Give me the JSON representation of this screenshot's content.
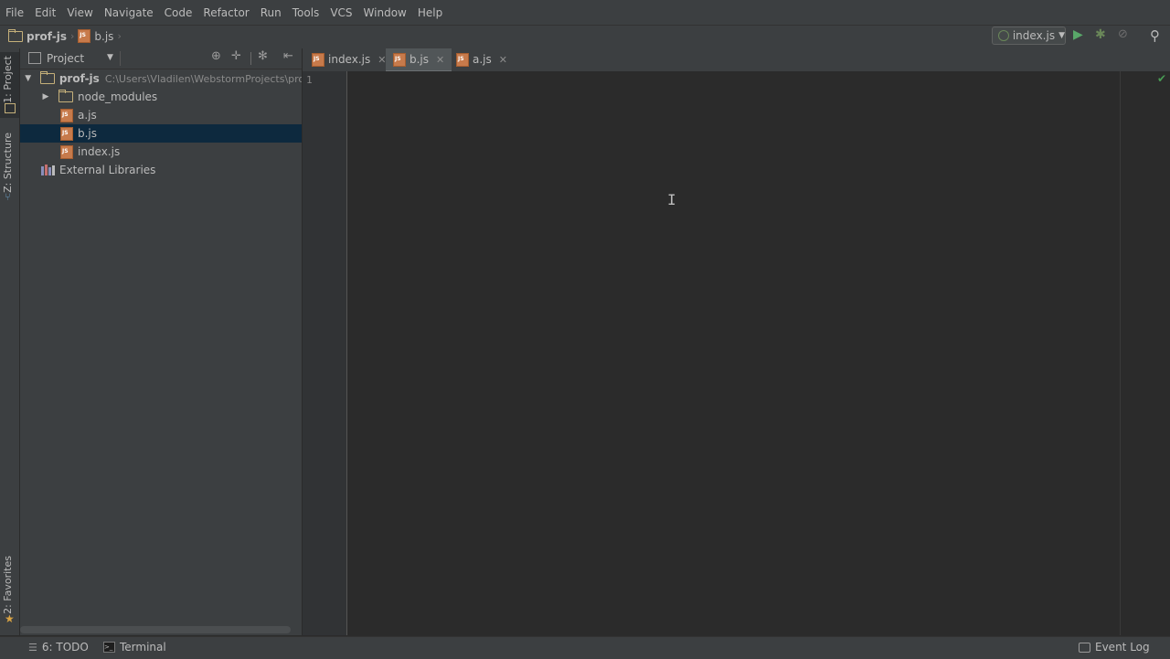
{
  "menu": [
    "File",
    "Edit",
    "View",
    "Navigate",
    "Code",
    "Refactor",
    "Run",
    "Tools",
    "VCS",
    "Window",
    "Help"
  ],
  "breadcrumb": {
    "project": "prof-js",
    "file": "b.js"
  },
  "run_config": {
    "label": "index.js"
  },
  "left_strip": {
    "project_tab": "1: Project",
    "structure_tab": "Z: Structure",
    "favorites_tab": "2: Favorites"
  },
  "project_panel": {
    "view_selector": "Project",
    "tree": {
      "root_name": "prof-js",
      "root_path": "C:\\Users\\Vladilen\\WebstormProjects\\prof-",
      "items": [
        "node_modules",
        "a.js",
        "b.js",
        "index.js"
      ],
      "external": "External Libraries"
    }
  },
  "tabs": [
    "index.js",
    "b.js",
    "a.js"
  ],
  "active_tab": "b.js",
  "editor": {
    "line_numbers": [
      "1"
    ]
  },
  "status": {
    "todo": "6: TODO",
    "terminal": "Terminal",
    "event_log": "Event Log"
  },
  "colors": {
    "selection": "#0d293e",
    "accent_green": "#499c54",
    "run_green": "#59a869",
    "js_icon": "#c77a4b"
  }
}
